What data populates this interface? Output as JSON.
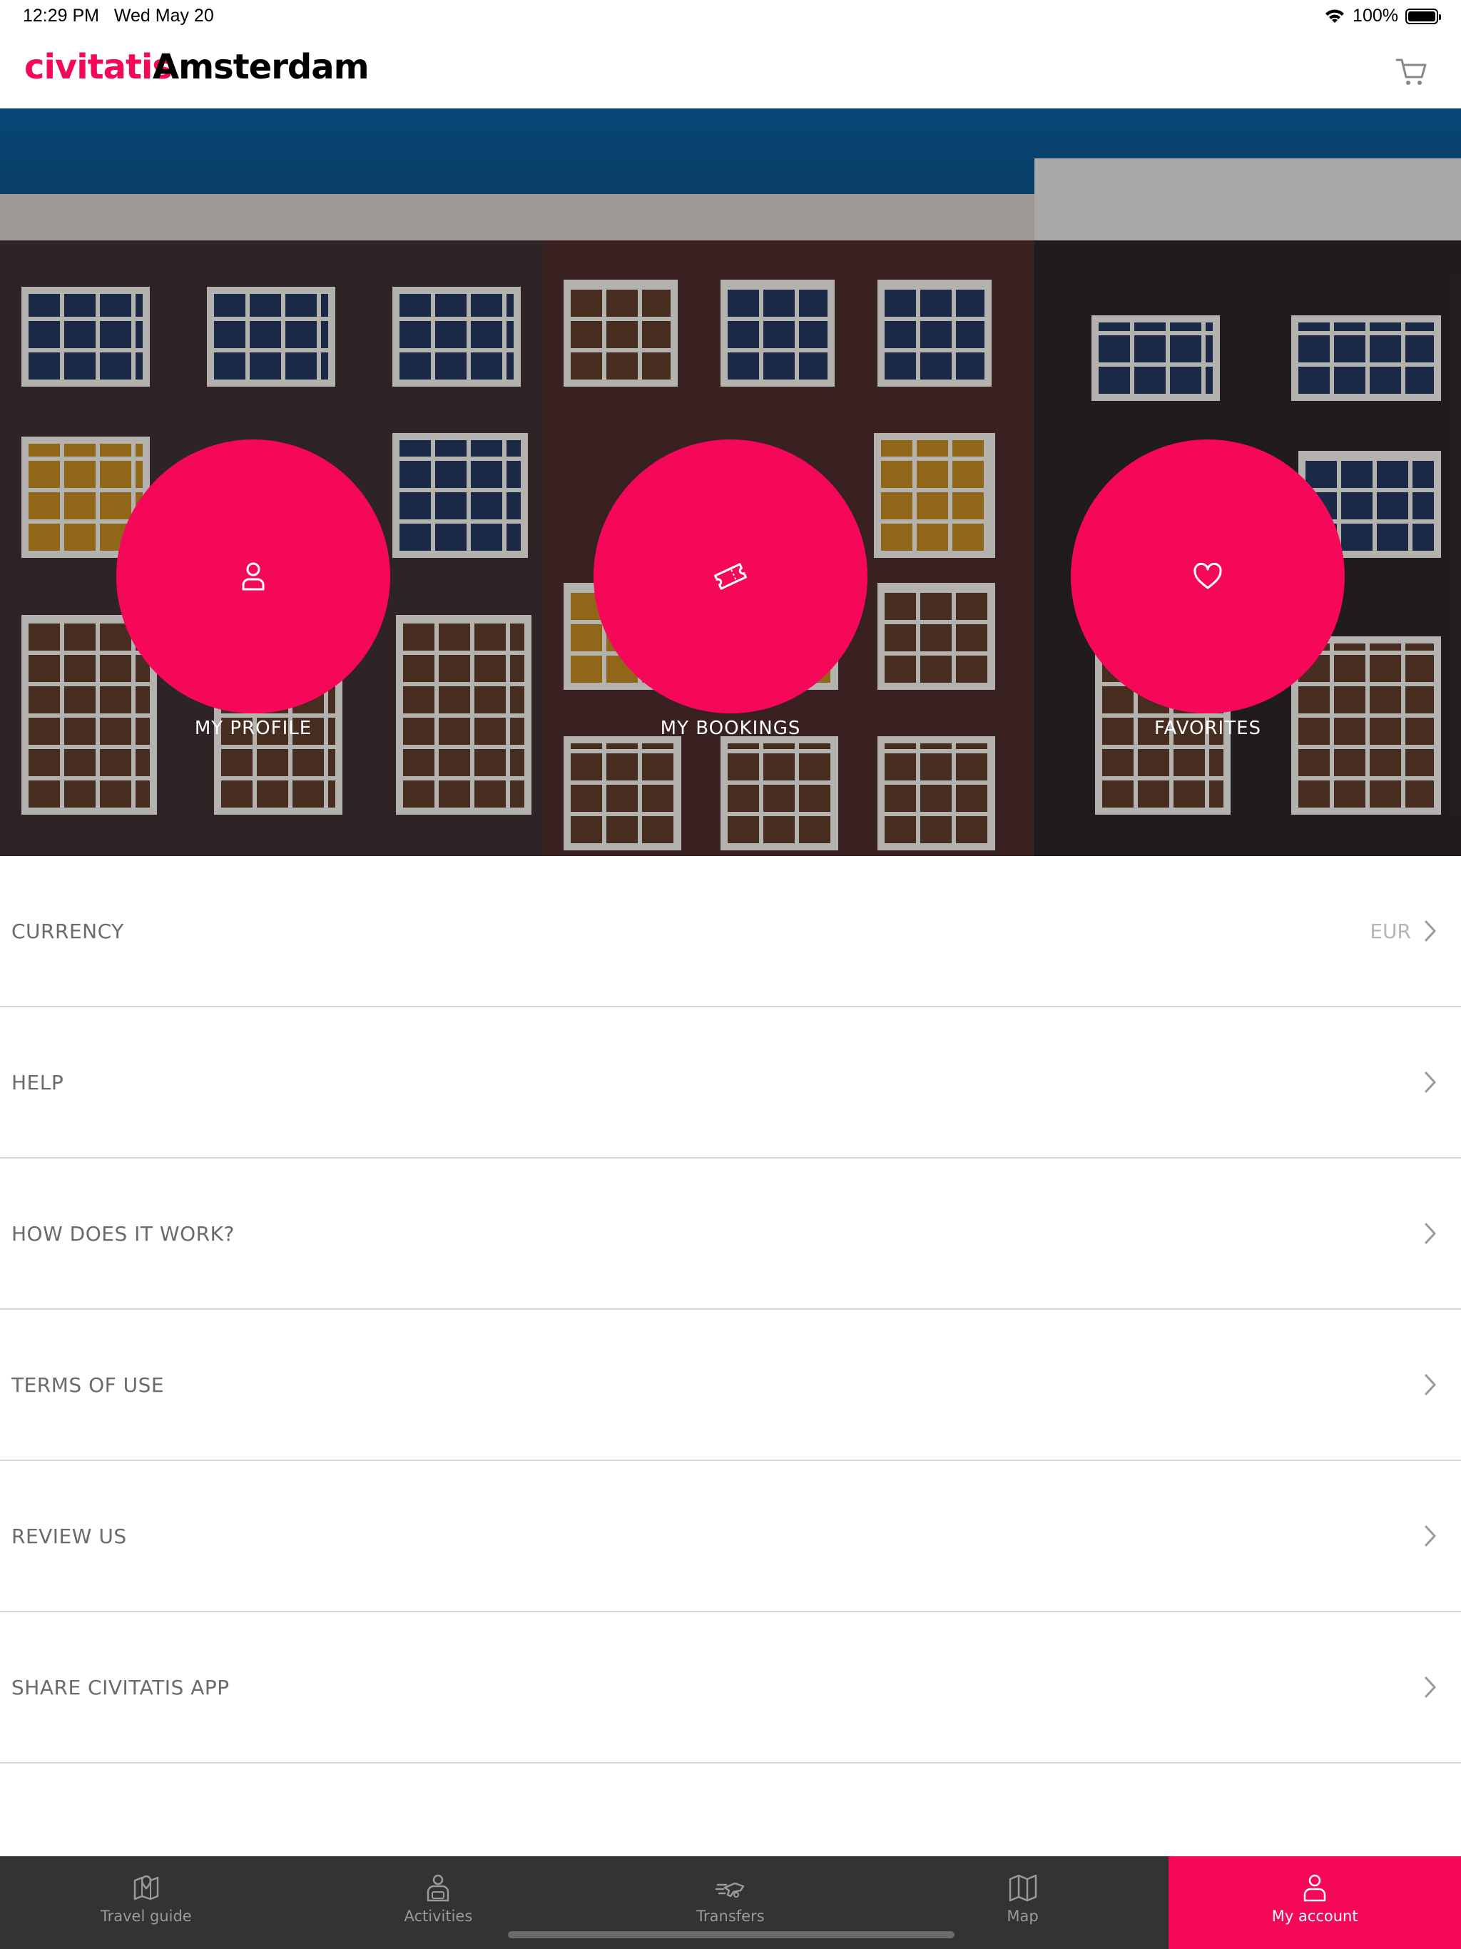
{
  "status_bar": {
    "time": "12:29 PM",
    "date": "Wed May 20",
    "battery": "100%"
  },
  "header": {
    "logo": "civitatis",
    "city": "Amsterdam",
    "cart_icon": "cart-icon"
  },
  "hero": {
    "actions": [
      {
        "label": "MY PROFILE",
        "icon": "user-icon"
      },
      {
        "label": "MY BOOKINGS",
        "icon": "ticket-icon"
      },
      {
        "label": "FAVORITES",
        "icon": "heart-icon"
      }
    ]
  },
  "menu": {
    "items": [
      {
        "label": "CURRENCY",
        "value": "EUR"
      },
      {
        "label": "HELP"
      },
      {
        "label": "HOW DOES IT WORK?"
      },
      {
        "label": "TERMS OF USE"
      },
      {
        "label": "REVIEW US"
      },
      {
        "label": "SHARE CIVITATIS APP"
      }
    ]
  },
  "tabbar": {
    "tabs": [
      {
        "label": "Travel guide",
        "icon": "map-pin-book-icon"
      },
      {
        "label": "Activities",
        "icon": "activities-icon"
      },
      {
        "label": "Transfers",
        "icon": "transfers-icon"
      },
      {
        "label": "Map",
        "icon": "map-icon"
      },
      {
        "label": "My account",
        "icon": "user-icon"
      }
    ],
    "active": "My account"
  },
  "colors": {
    "accent": "#f5085a",
    "tabbar_bg": "#333333"
  }
}
